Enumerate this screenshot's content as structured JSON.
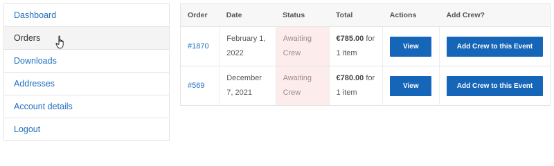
{
  "sidebar": {
    "items": [
      {
        "label": "Dashboard"
      },
      {
        "label": "Orders"
      },
      {
        "label": "Downloads"
      },
      {
        "label": "Addresses"
      },
      {
        "label": "Account details"
      },
      {
        "label": "Logout"
      }
    ],
    "active": "Orders"
  },
  "orders_table": {
    "headers": [
      "Order",
      "Date",
      "Status",
      "Total",
      "Actions",
      "Add Crew?"
    ],
    "rows": [
      {
        "order": "#1870",
        "date": "February 1, 2022",
        "status": "Awaiting Crew",
        "total_amount": "€785.00",
        "total_suffix": " for 1 item",
        "action_label": "View",
        "crew_label": "Add Crew to this Event"
      },
      {
        "order": "#569",
        "date": "December 7, 2021",
        "status": "Awaiting Crew",
        "total_amount": "€780.00",
        "total_suffix": " for 1 item",
        "action_label": "View",
        "crew_label": "Add Crew to this Event"
      }
    ]
  },
  "colors": {
    "link": "#1f6fbf",
    "button": "#1565b8",
    "status_bg": "#fdecec"
  },
  "icons": {
    "cursor": "hand-pointer-icon"
  }
}
